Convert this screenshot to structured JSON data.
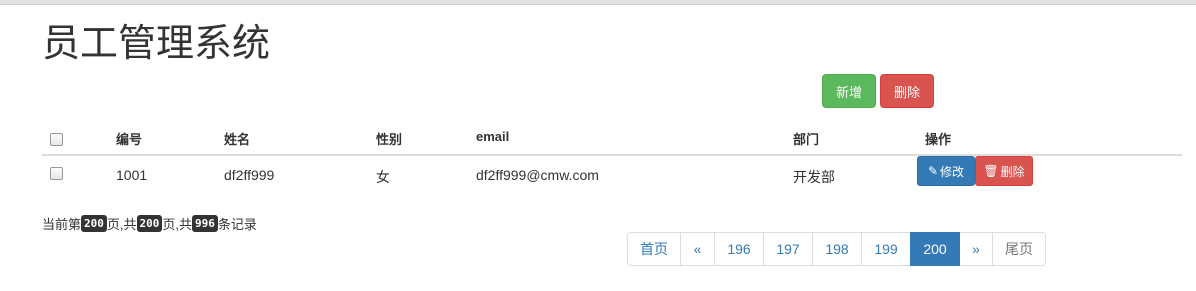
{
  "page": {
    "title": "员工管理系统"
  },
  "toolbar": {
    "add_label": "新增",
    "delete_label": "删除",
    "colors": {
      "success": "#5cb85c",
      "danger": "#d9534f",
      "primary": "#337ab7"
    }
  },
  "table": {
    "headers": [
      "编号",
      "姓名",
      "性别",
      "email",
      "部门",
      "操作"
    ],
    "rows": [
      {
        "id": "1001",
        "name": "df2ff999",
        "gender": "女",
        "email": "df2ff999@cmw.com",
        "dept": "开发部",
        "edit_label": "修改",
        "delete_label": "删除",
        "edit_icon": "pencil-icon",
        "delete_icon": "trash-icon"
      }
    ]
  },
  "page_info": {
    "prefix": "当前第",
    "current": "200",
    "mid1": "页,共",
    "total_pages": "200",
    "mid2": "页,共",
    "total_records": "996",
    "suffix": "条记录"
  },
  "pagination": {
    "first": "首页",
    "prev": "«",
    "pages": [
      "196",
      "197",
      "198",
      "199",
      "200"
    ],
    "active": "200",
    "next": "»",
    "last": "尾页"
  }
}
